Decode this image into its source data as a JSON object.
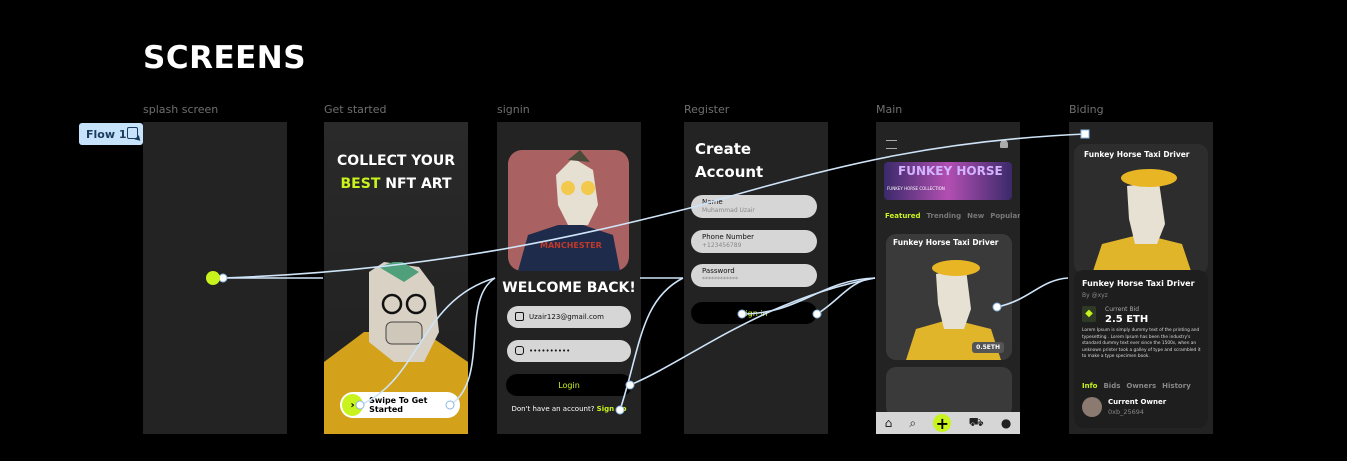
{
  "page_title": "SCREENS",
  "flow_tag": "Flow 1",
  "frames": {
    "splash": {
      "label": "splash screen"
    },
    "get_started": {
      "label": "Get started",
      "heading_line1": "COLLECT YOUR",
      "heading_best": "BEST",
      "heading_rest": " NFT ART",
      "swipe_label": "Swipe To Get Started"
    },
    "signin": {
      "label": "signin",
      "welcome": "WELCOME BACK!",
      "email": "Uzair123@gmail.com",
      "password": "••••••••••",
      "login": "Login",
      "no_account": "Don't have an account?",
      "sign_up": "Sign up"
    },
    "register": {
      "label": "Register",
      "heading1": "Create",
      "heading2": "Account",
      "fields": [
        {
          "label": "Name",
          "value": "Muhammad Uzair"
        },
        {
          "label": "Phone Number",
          "value": "+123456789"
        },
        {
          "label": "Password",
          "value": "************"
        }
      ],
      "sign_in": "Sign in"
    },
    "main": {
      "label": "Main",
      "banner_title": "FUNKEY HORSE",
      "banner_sub": "FUNKEY HORSE COLLECTION",
      "tabs": [
        "Featured",
        "Trending",
        "New",
        "Popular"
      ],
      "card_title": "Funkey Horse Taxi Driver",
      "price_badge": "0.5ETH"
    },
    "biding": {
      "label": "Biding",
      "top_title": "Funkey Horse Taxi Driver",
      "title": "Funkey Horse Taxi Driver",
      "by": "By @xyz",
      "current_bid_label": "Current Bid",
      "current_bid_value": "2.5 ETH",
      "description": "Lorem Ipsum is simply dummy text of the printing and typesetting . Lorem Ipsum has been the industry's standard dummy text ever since the 1500s, when an unknown printer took a galley of type and scrambled it to make a type specimen book.",
      "tabs": [
        "Info",
        "Bids",
        "Owners",
        "History"
      ],
      "owner_label": "Current Owner",
      "owner_value": "0xb_25694"
    }
  },
  "colors": {
    "accent": "#c8f31d",
    "frame_bg": "#232323",
    "wire": "#cfe4f8"
  }
}
